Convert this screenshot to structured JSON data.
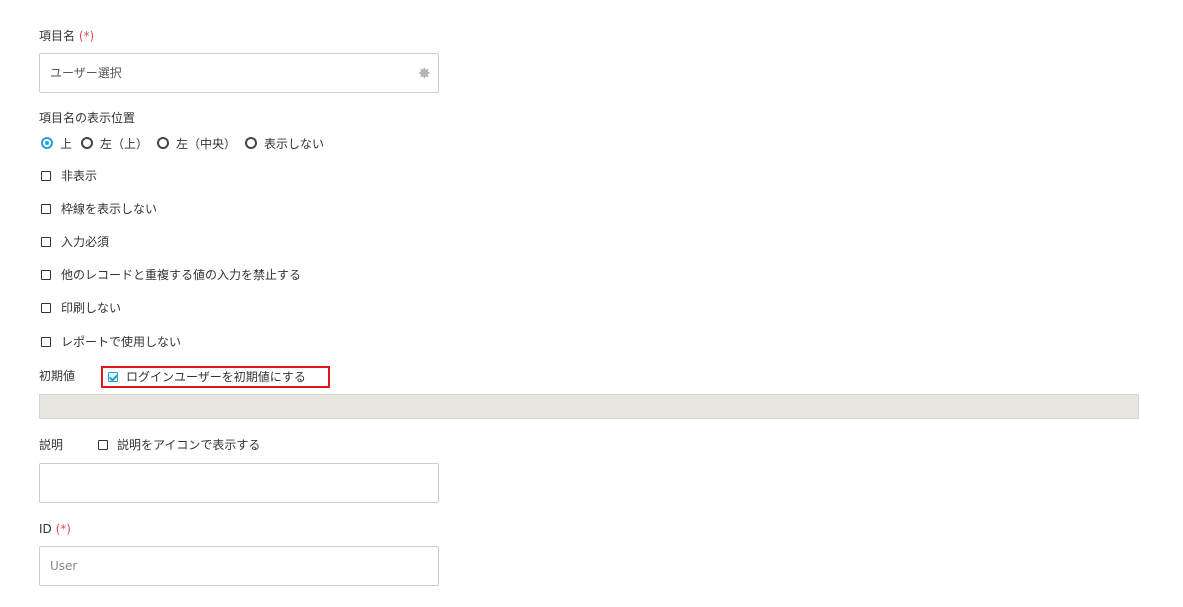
{
  "item_name": {
    "label": "項目名",
    "required_mark": "(*)",
    "value": "ユーザー選択",
    "icon": "gear-icon"
  },
  "label_position": {
    "label": "項目名の表示位置",
    "options": [
      "上",
      "左（上）",
      "左（中央）",
      "表示しない"
    ],
    "selected": "上"
  },
  "checkboxes": [
    {
      "label": "非表示",
      "checked": false
    },
    {
      "label": "枠線を表示しない",
      "checked": false
    },
    {
      "label": "入力必須",
      "checked": false
    },
    {
      "label": "他のレコードと重複する値の入力を禁止する",
      "checked": false
    },
    {
      "label": "印刷しない",
      "checked": false
    },
    {
      "label": "レポートで使用しない",
      "checked": false
    }
  ],
  "initial_value": {
    "label": "初期値",
    "login_user_checkbox": {
      "label": "ログインユーザーを初期値にする",
      "checked": true
    }
  },
  "description": {
    "label": "説明",
    "icon_checkbox": {
      "label": "説明をアイコンで表示する",
      "checked": false
    },
    "value": ""
  },
  "id_field": {
    "label": "ID",
    "required_mark": "(*)",
    "placeholder": "User"
  },
  "colors": {
    "accent": "#2a9fd6",
    "required": "#d9534f",
    "highlight": "#e0161d",
    "disabled_bar": "#e8e7df"
  }
}
